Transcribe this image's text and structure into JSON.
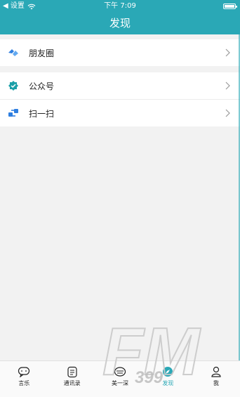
{
  "status": {
    "back_label": "◀ 设置",
    "time": "下午 7:09"
  },
  "nav": {
    "title": "发现"
  },
  "list": {
    "items": [
      {
        "label": "朋友圈",
        "icon": "moments-icon"
      },
      {
        "label": "公众号",
        "icon": "official-account-icon"
      },
      {
        "label": "扫一扫",
        "icon": "scan-icon"
      }
    ]
  },
  "tabbar": {
    "items": [
      {
        "label": "言乐",
        "icon": "chat-icon",
        "active": false
      },
      {
        "label": "通讯录",
        "icon": "contacts-icon",
        "active": false
      },
      {
        "label": "美一深",
        "icon": "beauty-icon",
        "active": false
      },
      {
        "label": "发现",
        "icon": "discover-icon",
        "active": true
      },
      {
        "label": "我",
        "icon": "profile-icon",
        "active": false
      }
    ]
  },
  "watermark": {
    "text": "FM",
    "subtext": "399"
  },
  "colors": {
    "accent": "#2aa8b6",
    "icon_blue": "#2f7fe0",
    "icon_teal": "#1b9fa8"
  }
}
